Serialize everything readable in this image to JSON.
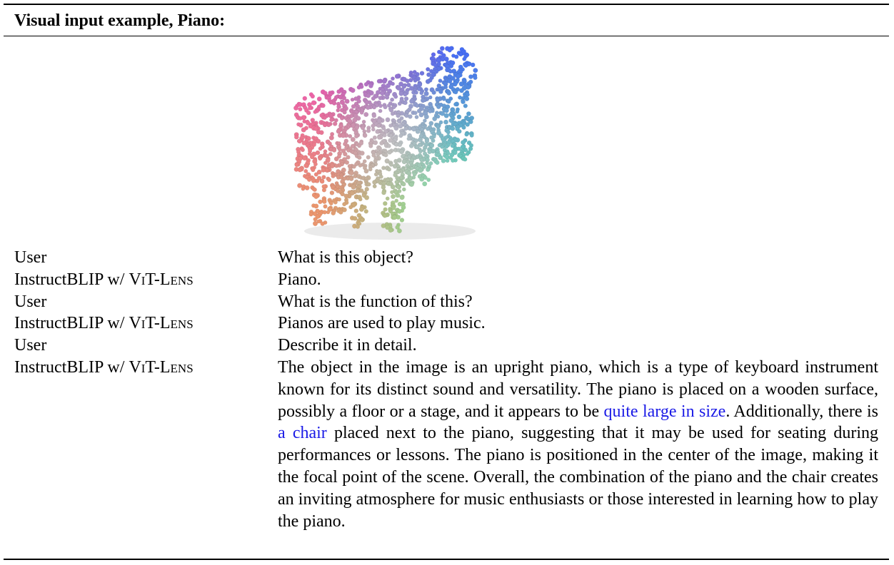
{
  "header": {
    "title": "Visual input example, Piano:"
  },
  "figure": {
    "subject": "point-cloud-piano"
  },
  "dialogue": {
    "user_label": "User",
    "model_label_prefix": "InstructBLIP w/ ",
    "model_label_name": "ViT-Lens",
    "turns": [
      {
        "text": "What is this object?"
      },
      {
        "text": "Piano."
      },
      {
        "text": "What is the function of this?"
      },
      {
        "text": "Pianos are used to play music."
      },
      {
        "text": "Describe it in detail."
      },
      {
        "text_1": "The object in the image is an upright piano, which is a type of keyboard instrument known for its distinct sound and versatility. The piano is placed on a wooden surface, possibly a floor or a stage, and it appears to be ",
        "highlight_1": "quite large in size",
        "text_2": ". Additionally, there is ",
        "highlight_2": "a chair",
        "text_3": " placed next to the piano, suggesting that it may be used for seating during performances or lessons. The piano is positioned in the center of the image, making it the focal point of the scene. Overall, the combination of the piano and the chair creates an inviting atmosphere for music enthusiasts or those interested in learning how to play the piano."
      }
    ]
  },
  "colors": {
    "highlight": "#1a1ae6",
    "rule": "#000000"
  }
}
